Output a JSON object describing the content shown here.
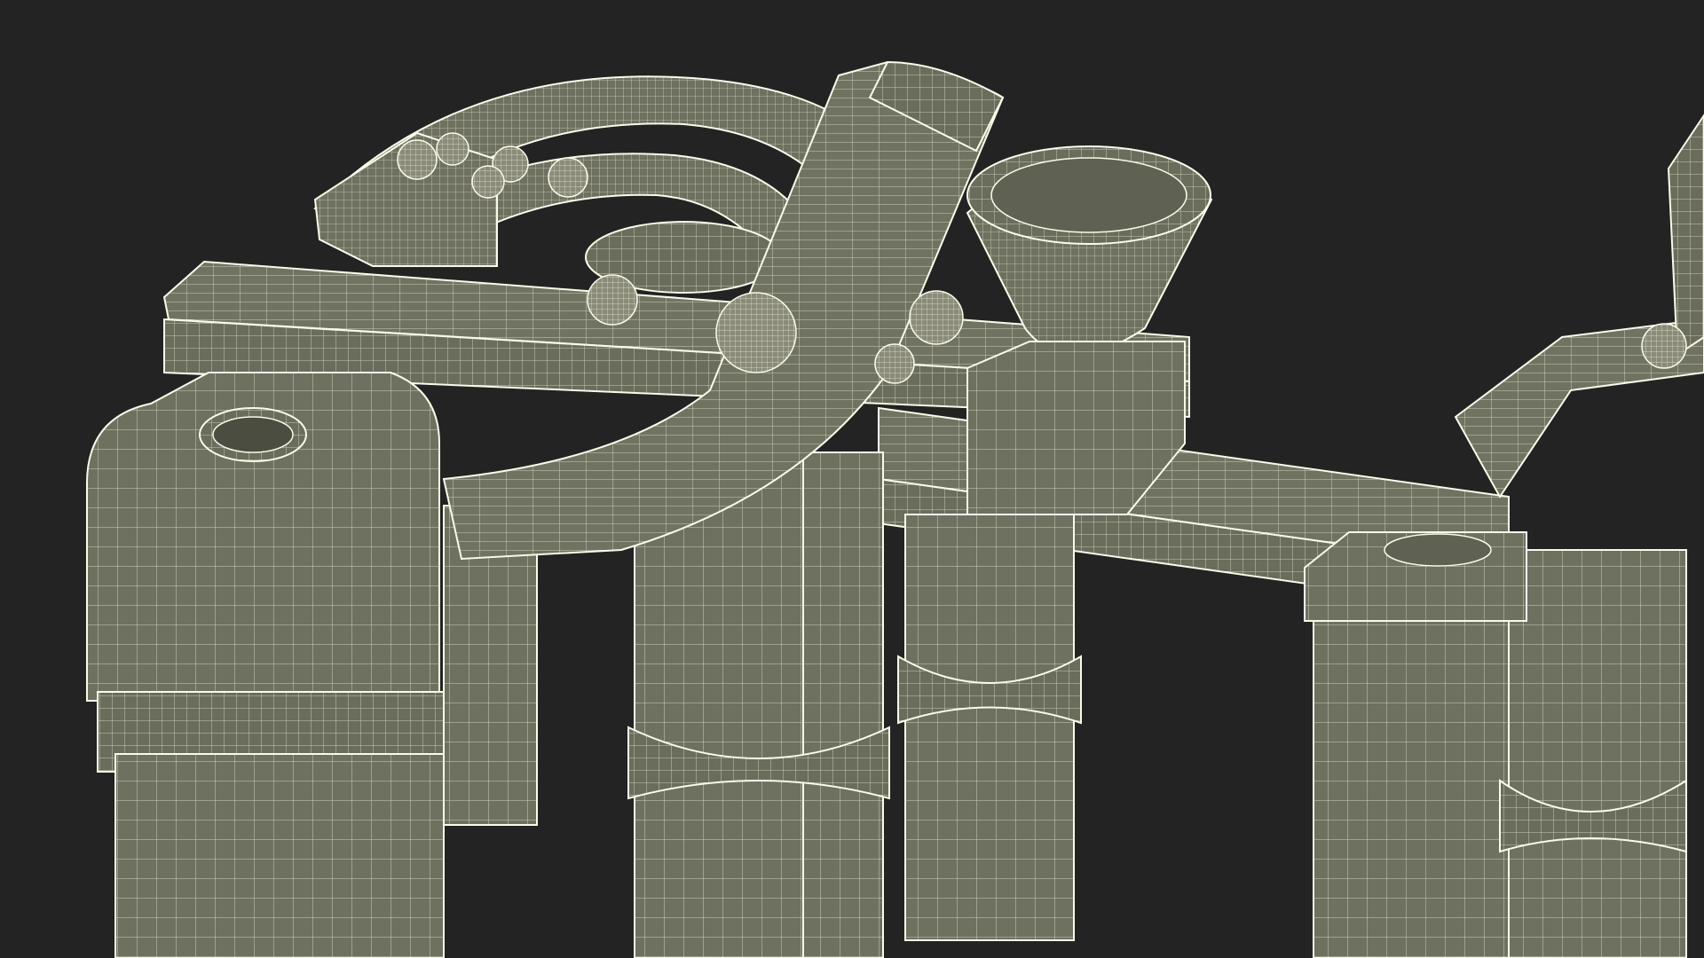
{
  "scene": {
    "background": "#232323",
    "surface_fill": "#6e7060",
    "surface_fill_dark": "#5f6152",
    "surface_fill_light": "#7a7c6b",
    "wire_color": "#f1f1dc",
    "outline_color": "#fafaea"
  }
}
